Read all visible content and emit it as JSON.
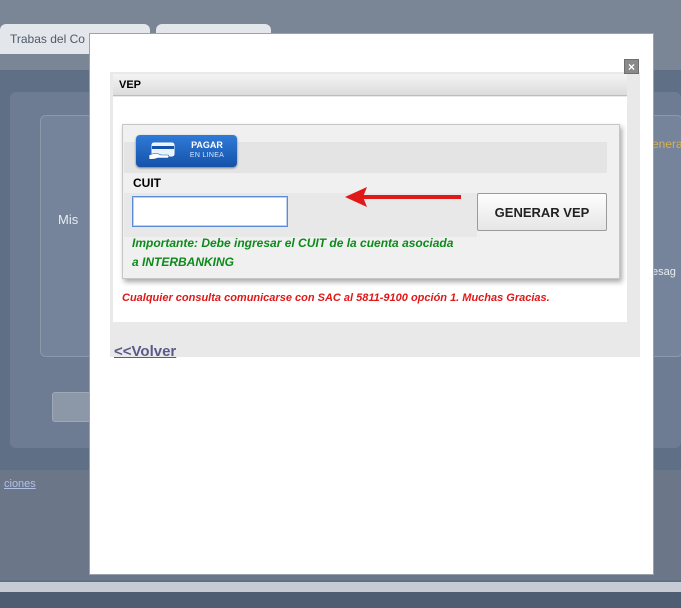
{
  "background": {
    "tab1_label": "Trabas del Co",
    "mis_label": "Mis",
    "genera_label": "enera",
    "mensajes_label": "esag",
    "footer_link": "ciones"
  },
  "modal": {
    "close_label": "×",
    "header_title": "VEP",
    "pagar_button": {
      "line1": "PAGAR",
      "line2": "EN LINEA"
    },
    "cuit_label": "CUIT",
    "cuit_value": "",
    "generate_button_label": "GENERAR VEP",
    "important_note": "Importante: Debe ingresar el CUIT de la cuenta asociada a INTERBANKING",
    "consulta_note": "Cualquier consulta comunicarse con SAC al 5811-9100 opción 1. Muchas Gracias.",
    "back_link_label": "<<Volver"
  },
  "colors": {
    "accent_blue": "#1552a9",
    "note_green": "#0e8a1c",
    "note_red": "#e01818",
    "arrow_red": "#e01818"
  },
  "icons": {
    "close": "close-icon",
    "pagar": "card-hand-icon",
    "arrow": "arrow-left-icon"
  }
}
